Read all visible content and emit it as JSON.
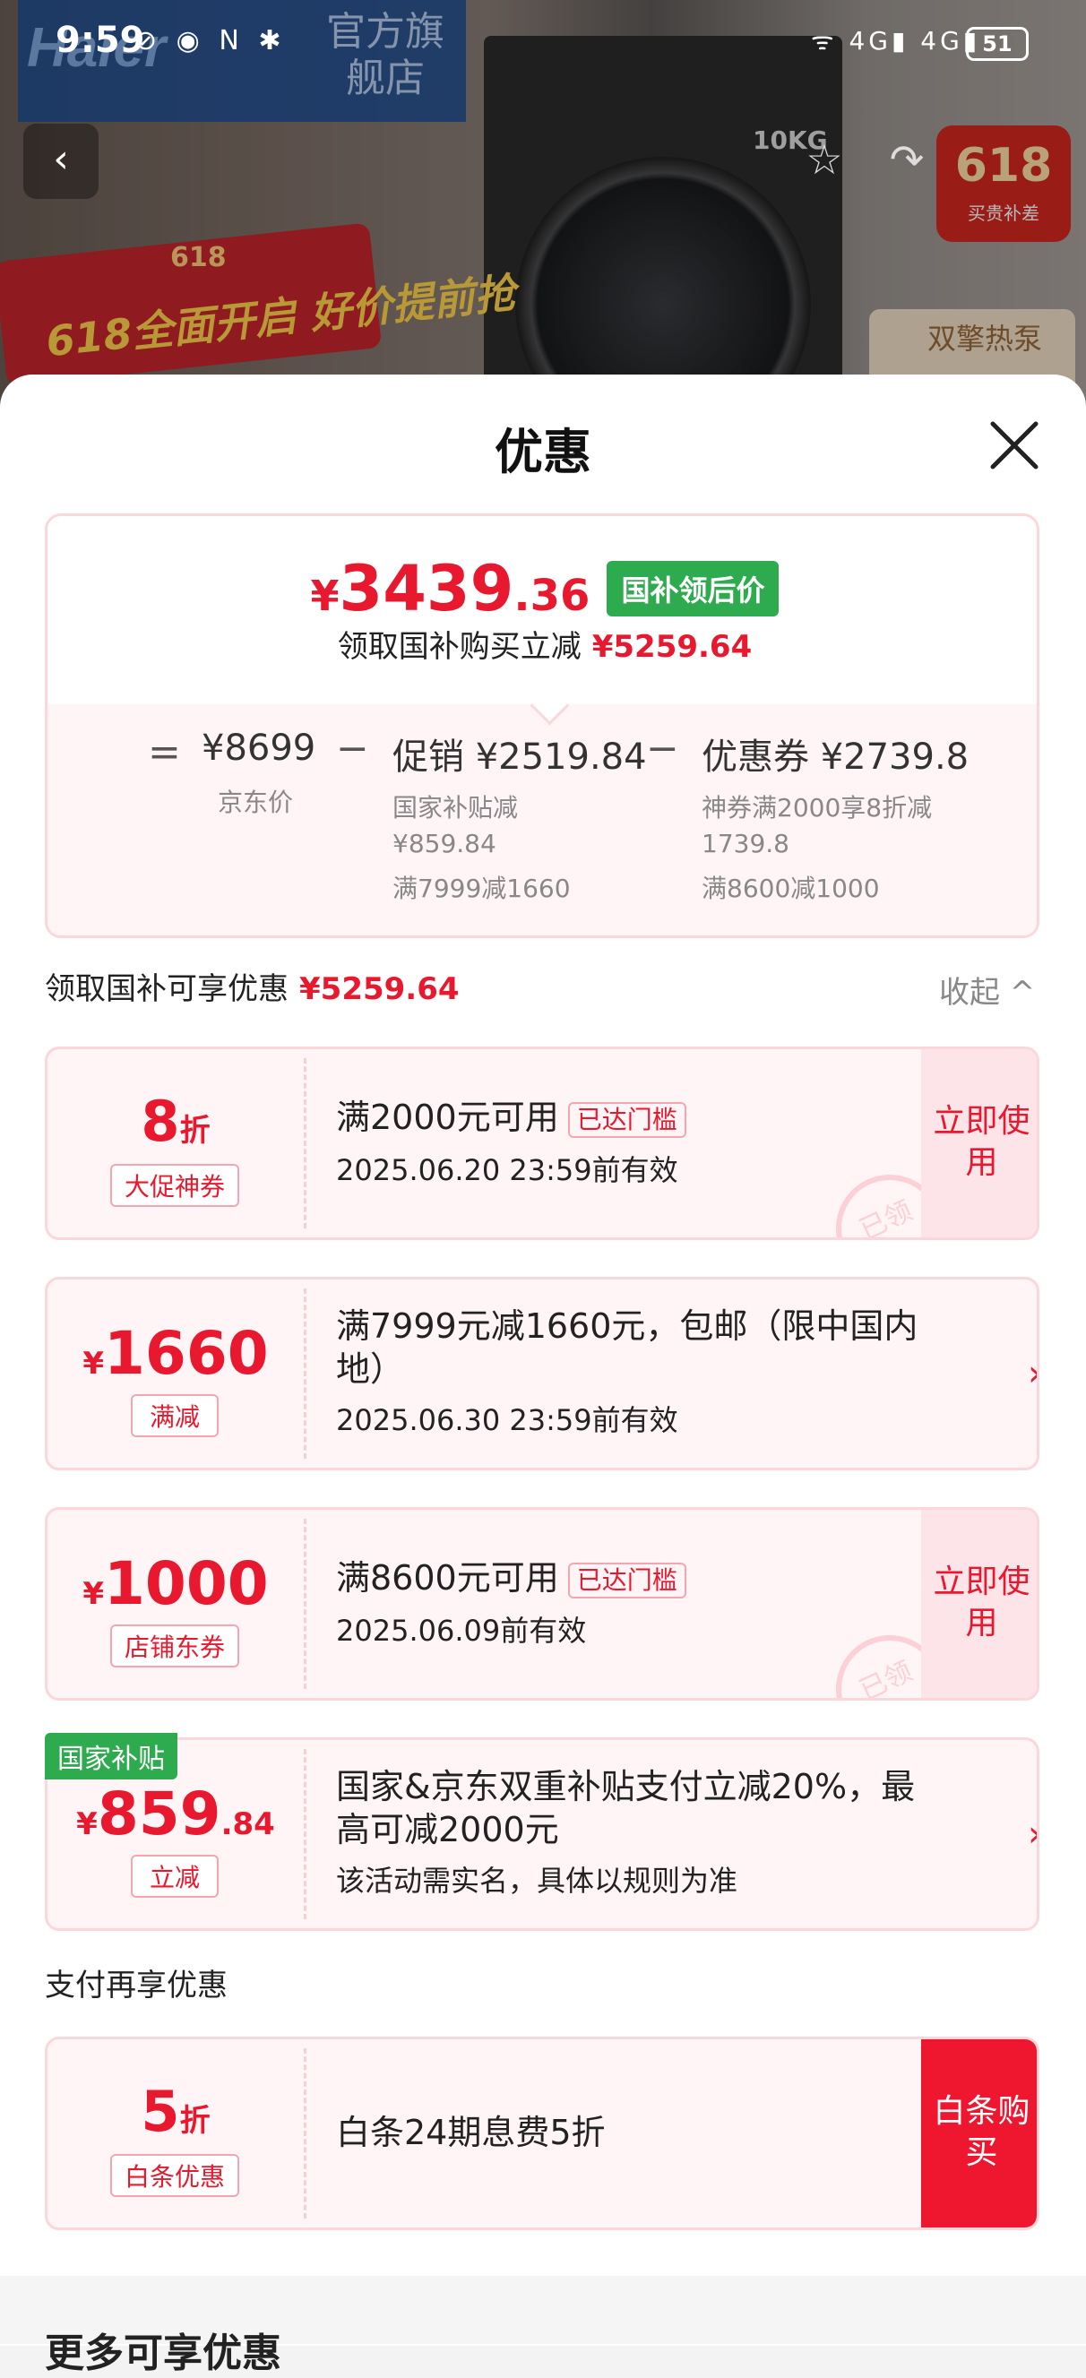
{
  "status_bar": {
    "time": "9:59",
    "left_icons": "⊘ ◉ N ✱",
    "right_icons": "ᯤ 4G▮ 4G▮",
    "battery": "51"
  },
  "background": {
    "brand_logo": "Haier",
    "brand_store": "官方旗舰店",
    "washer_capacity": "10KG",
    "promo_badge": "618全面开启 好价提前抢",
    "promo_618": "618",
    "right_tag": "618",
    "right_tag_sub": "买贵补差",
    "side_box": "双擎热泵"
  },
  "sheet": {
    "title": "优惠"
  },
  "summary": {
    "price_yen": "¥",
    "price_int": "3439",
    "price_dec": ".36",
    "price_tag": "国补领后价",
    "sub_text": "领取国补购买立减",
    "sub_amount": "¥5259.64",
    "jd_price": "¥8699",
    "jd_price_label": "京东价",
    "promo_label": "促销 ¥2519.84",
    "promo_detail_1": "国家补贴减",
    "promo_detail_2": "¥859.84",
    "promo_detail_3": "满7999减1660",
    "coupon_label": "优惠券 ¥2739.8",
    "coupon_detail_1": "神券满2000享8折减",
    "coupon_detail_2": "1739.8",
    "coupon_detail_3": "满8600减1000",
    "op_eq": "=",
    "op_minus": "−"
  },
  "section1": {
    "label": "领取国补可享优惠",
    "amount": "¥5259.64",
    "collapse": "收起 ^"
  },
  "coupons": [
    {
      "big": "8",
      "unit": "折",
      "tag": "大促神券",
      "text": "满2000元可用",
      "badge": "已达门槛",
      "date": "2025.06.20 23:59前有效",
      "action": "立即使用",
      "stamp": "已领"
    },
    {
      "big": "1660",
      "unit": "¥",
      "tag": "满减",
      "text": "满7999元减1660元，包邮（限中国内地）",
      "date": "2025.06.30 23:59前有效"
    },
    {
      "big": "1000",
      "unit": "¥",
      "tag": "店铺东券",
      "text": "满8600元可用",
      "badge": "已达门槛",
      "date": "2025.06.09前有效",
      "action": "立即使用",
      "stamp": "已领"
    },
    {
      "label": "国家补贴",
      "big": "859",
      "dec": ".84",
      "unit": "¥",
      "tag": "立减",
      "text": "国家&京东双重补贴支付立减20%，最高可减2000元",
      "date": "该活动需实名，具体以规则为准"
    }
  ],
  "section2": {
    "label": "支付再享优惠"
  },
  "payment": {
    "big": "5",
    "unit": "折",
    "tag": "白条优惠",
    "text": "白条24期息费5折",
    "action": "白条购买"
  },
  "footer": {
    "text": "更多可享优惠"
  }
}
